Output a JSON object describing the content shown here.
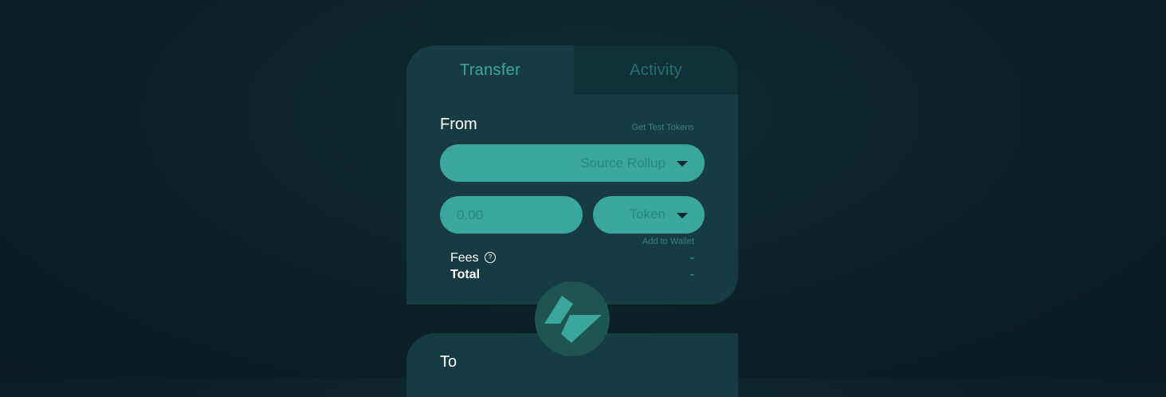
{
  "tabs": {
    "transfer": "Transfer",
    "activity": "Activity"
  },
  "from": {
    "label": "From",
    "get_test_tokens": "Get Test Tokens",
    "source_select": "Source Rollup",
    "amount_placeholder": "0.00",
    "token_select": "Token",
    "add_to_wallet": "Add to Wallet",
    "fees_label": "Fees",
    "fees_value": "-",
    "total_label": "Total",
    "total_value": "-",
    "help_glyph": "?"
  },
  "to": {
    "label": "To"
  },
  "icons": {
    "swap": "swap-direction-icon",
    "dropdown": "chevron-down-icon",
    "help": "question-circle-icon"
  },
  "colors": {
    "background": "#0b2127",
    "card": "#163b44",
    "tab_inactive": "#10313a",
    "accent": "#3ba69e",
    "accent_text": "#2a8780",
    "swap_button": "#1e5553"
  }
}
